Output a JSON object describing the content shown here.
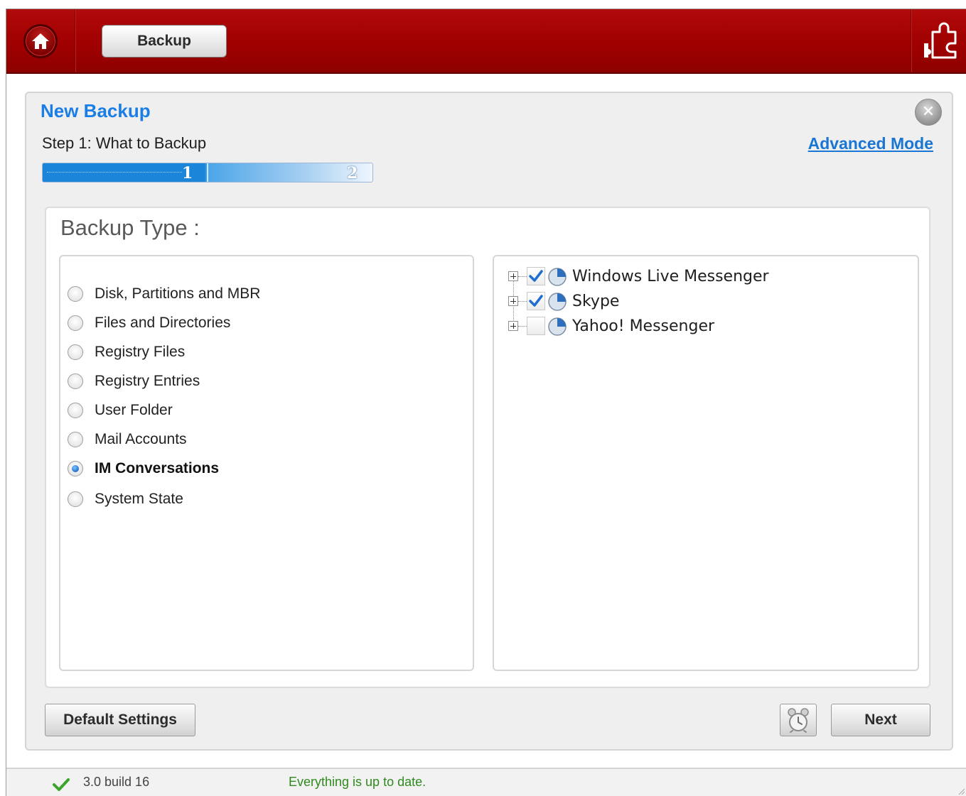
{
  "header": {
    "home_icon": "home-icon",
    "tab_label": "Backup",
    "plugin_icon": "plugin-puzzle-icon",
    "accent_color": "#a00000"
  },
  "dialog": {
    "title": "New Backup",
    "close_icon": "close-icon",
    "step_label": "Step 1: What to Backup",
    "advanced_link": "Advanced Mode",
    "progress": {
      "current_step": "1",
      "next_step": "2",
      "fraction_complete": 0.5
    }
  },
  "backup_type": {
    "title": "Backup Type :",
    "options": [
      {
        "label": "Disk, Partitions and MBR",
        "selected": false
      },
      {
        "label": "Files and Directories",
        "selected": false
      },
      {
        "label": "Registry Files",
        "selected": false
      },
      {
        "label": "Registry Entries",
        "selected": false
      },
      {
        "label": "User Folder",
        "selected": false
      },
      {
        "label": "Mail Accounts",
        "selected": false
      },
      {
        "label": "IM Conversations",
        "selected": true
      },
      {
        "label": "System State",
        "selected": false
      }
    ],
    "im_clients": [
      {
        "label": "Windows Live Messenger",
        "checked": true,
        "icon": "messenger-app-icon"
      },
      {
        "label": "Skype",
        "checked": true,
        "icon": "messenger-app-icon"
      },
      {
        "label": "Yahoo! Messenger",
        "checked": false,
        "icon": "messenger-app-icon"
      }
    ]
  },
  "footer": {
    "default_settings_label": "Default Settings",
    "schedule_icon": "alarm-clock-icon",
    "next_label": "Next"
  },
  "status": {
    "version": "3.0 build 16",
    "message": "Everything is up to date.",
    "ok_icon": "checkmark-icon",
    "message_color": "#2f8a1e"
  }
}
